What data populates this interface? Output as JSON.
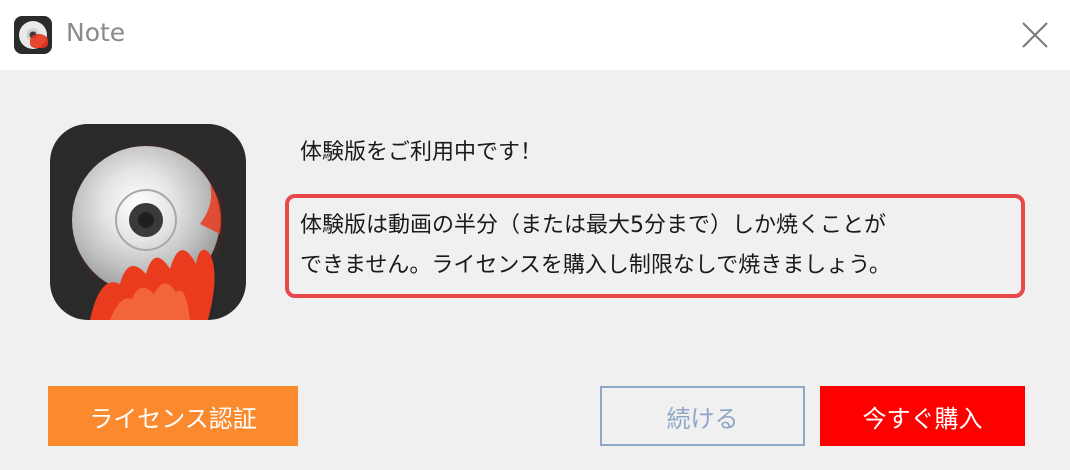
{
  "window": {
    "title": "Note"
  },
  "dialog": {
    "heading": "体験版をご利用中です！",
    "message_line1": "体験版は動画の半分（または最大5分まで）しか焼くことが",
    "message_line2": "できません。ライセンスを購入し制限なしで焼きましょう。"
  },
  "buttons": {
    "license_label": "ライセンス認証",
    "continue_label": "続ける",
    "buy_label": "今すぐ購入"
  },
  "colors": {
    "license_button": "#fb8a2e",
    "continue_border": "#8fa6c8",
    "buy_button": "#fe0000",
    "highlight_border": "#e8484a"
  },
  "icons": {
    "app": "cd-burner-flame-icon",
    "close": "close-icon"
  }
}
